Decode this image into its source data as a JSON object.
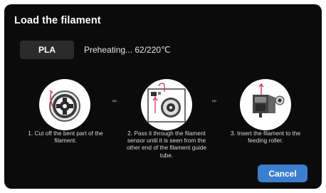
{
  "dialog": {
    "title": "Load the filament",
    "material": "PLA",
    "status": "Preheating...  62/220℃"
  },
  "steps": [
    {
      "text": "1. Cut off the bent part  of the filament.",
      "image": "filament-spool-cut"
    },
    {
      "text": "2. Pass it through the filament sensor until it is seen from the other end of the filament guide tube.",
      "image": "filament-sensor-spool"
    },
    {
      "text": "3. Insert the filament to the feeding roller.",
      "image": "extruder-feeding-roller"
    }
  ],
  "separators": {
    "glyph": "▸▸"
  },
  "actions": {
    "cancel_label": "Cancel"
  },
  "colors": {
    "background": "#0b0b0b",
    "pill": "#2b2b2b",
    "accent": "#3b7fd0",
    "filament": "#e2234a"
  }
}
